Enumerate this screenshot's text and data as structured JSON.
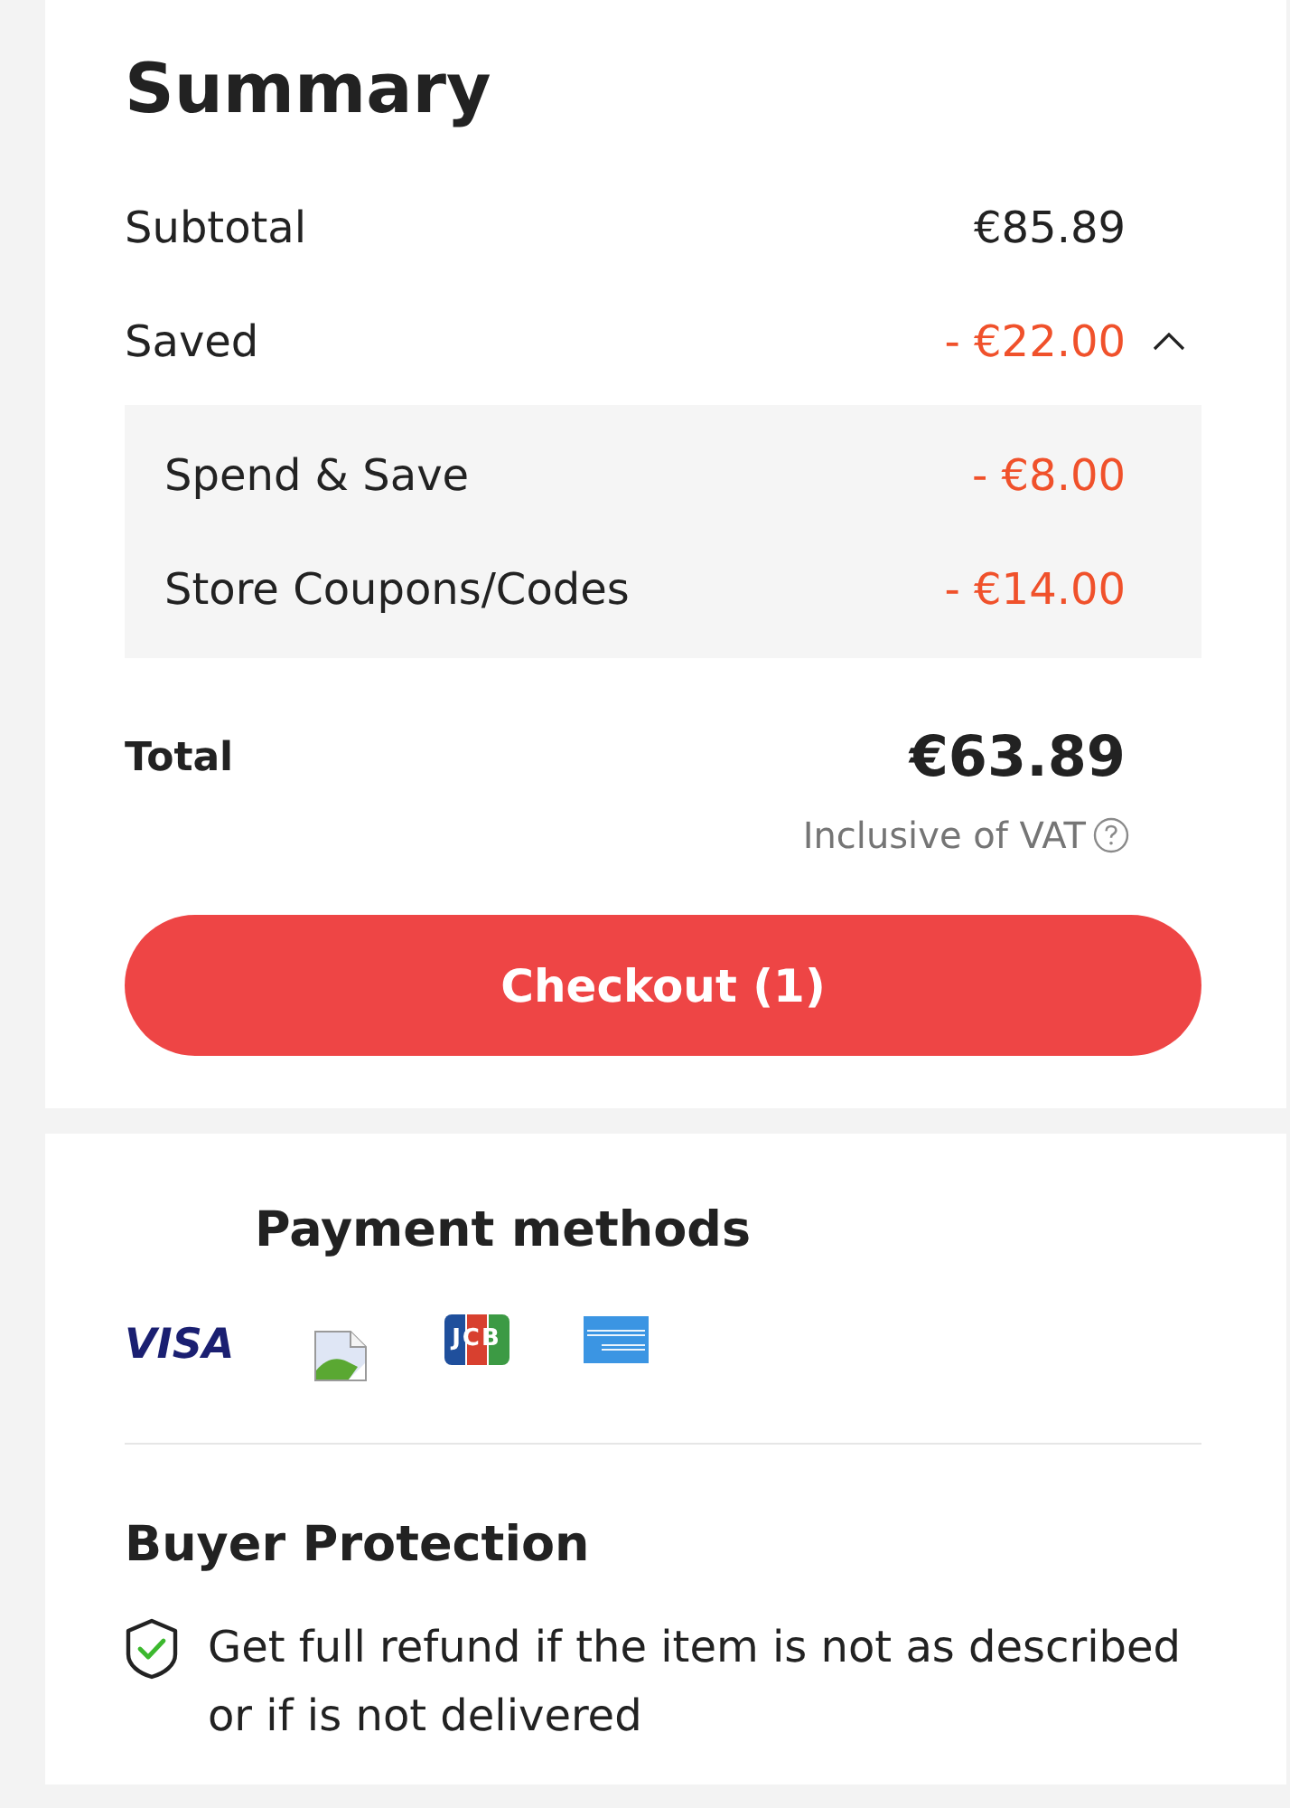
{
  "summary": {
    "title": "Summary",
    "subtotal": {
      "label": "Subtotal",
      "value": "€85.89"
    },
    "saved": {
      "label": "Saved",
      "value": "- €22.00",
      "expanded": true,
      "breakdown": [
        {
          "label": "Spend & Save",
          "value": "- €8.00"
        },
        {
          "label": "Store Coupons/Codes",
          "value": "- €14.00"
        }
      ]
    },
    "total": {
      "label": "Total",
      "value": "€63.89",
      "note": "Inclusive of VAT"
    },
    "checkout_button": "Checkout (1)"
  },
  "payment_methods": {
    "title": "Payment methods",
    "methods": [
      {
        "kind": "visa",
        "label": "VISA"
      },
      {
        "kind": "broken-image"
      },
      {
        "kind": "jcb",
        "label": "JCB"
      },
      {
        "kind": "amex"
      }
    ]
  },
  "buyer_protection": {
    "title": "Buyer Protection",
    "text": "Get full refund if the item is not as described or if is not delivered"
  }
}
